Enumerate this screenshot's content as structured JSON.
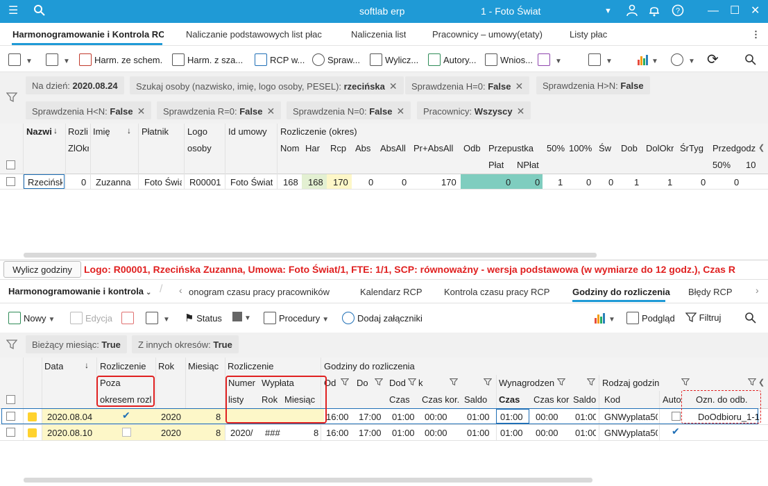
{
  "titlebar": {
    "app_title": "softlab erp",
    "company": "1 - Foto Świat",
    "icons": [
      "hamburger-icon",
      "search-icon",
      "user-icon",
      "bell-icon",
      "help-icon",
      "minimize-icon",
      "maximize-icon",
      "close-icon"
    ]
  },
  "main_tabs": [
    "Harmonogramowanie i Kontrola RCP",
    "Naliczanie podstawowych list płac",
    "Naliczenia list",
    "Pracownicy – umowy(etaty)",
    "Listy płac"
  ],
  "toolbar1": {
    "harm_schem": "Harm. ze schem.",
    "harm_sza": "Harm. z sza...",
    "rcp": "RCP w...",
    "spraw": "Spraw...",
    "wylicz": "Wylicz...",
    "autory": "Autory...",
    "wnios": "Wnios..."
  },
  "filters1": [
    {
      "label": "Na dzień: ",
      "value": "2020.08.24",
      "closable": false
    },
    {
      "label": "Szukaj osoby (nazwisko, imię, logo osoby, PESEL): ",
      "value": "rzecińska",
      "closable": true
    },
    {
      "label": "Sprawdzenia  H=0: ",
      "value": "False",
      "closable": true
    },
    {
      "label": "Sprawdzenia  H>N: ",
      "value": "False",
      "closable": false
    },
    {
      "label": "Sprawdzenia  H<N: ",
      "value": "False",
      "closable": true
    },
    {
      "label": "Sprawdzenia  R=0: ",
      "value": "False",
      "closable": true
    },
    {
      "label": "Sprawdzenia  N=0: ",
      "value": "False",
      "closable": true
    },
    {
      "label": "Pracownicy: ",
      "value": "Wszyscy",
      "closable": true
    }
  ],
  "grid1": {
    "headers": {
      "nazwisko": "Nazwi",
      "rozli": "Rozli",
      "zlokr": "ZlOkr",
      "imie": "Imię",
      "platnik": "Płatnik",
      "logo": "Logo",
      "osoby": "osoby",
      "id_umowy": "Id umowy",
      "rozliczenie_okres": "Rozliczenie (okres)",
      "nom": "Nom",
      "har": "Har",
      "rcp": "Rcp",
      "abs": "Abs",
      "absall": "AbsAll",
      "prabsall": "Pr+AbsAll",
      "odb": "Odb",
      "przepustka": "Przepustka",
      "plat": "Płat",
      "nplat": "NPłat",
      "p50": "50%",
      "p100": "100%",
      "sw": "Św",
      "dob": "Dob",
      "dolokr": "DolOkr",
      "srtyg": "ŚrTyg",
      "przedgodz": "Przedgodz",
      "pd50": "50%",
      "pd10": "10"
    },
    "row": {
      "nazwisko": "Rzeciński",
      "zlokr": "0",
      "imie": "Zuzanna",
      "platnik": "Foto Świat",
      "logo": "R00001",
      "id_umowy": "Foto Świat",
      "nom": "168",
      "har": "168",
      "rcp": "170",
      "abs": "0",
      "absall": "0",
      "prabsall": "170",
      "plat": "0",
      "nplat": "0",
      "p50": "1",
      "p100": "0",
      "sw": "0",
      "dob": "1",
      "dolokr": "1",
      "srtyg": "0",
      "przedgodz": "0"
    }
  },
  "info": {
    "button": "Wylicz godziny",
    "text": "Logo: R00001, Rzecińska Zuzanna, Umowa: Foto Świat/1, FTE: 1/1, SCP: równoważny - wersja podstawowa (w wymiarze do 12 godz.), Czas R"
  },
  "sub_tabs": {
    "module": "Harmonogramowanie i kontrola",
    "items": [
      "onogram czasu pracy pracowników",
      "Kalendarz RCP",
      "Kontrola czasu pracy RCP",
      "Godziny do rozliczenia",
      "Błędy RCP"
    ]
  },
  "toolbar2": {
    "nowy": "Nowy",
    "edycja": "Edycja",
    "status": "Status",
    "procedury": "Procedury",
    "dodaj": "Dodaj załączniki",
    "podglad": "Podgląd",
    "filtruj": "Filtruj"
  },
  "filters2": [
    {
      "label": "Bieżący miesiąc: ",
      "value": "True"
    },
    {
      "label": "Z innych okresów: ",
      "value": "True"
    }
  ],
  "grid2": {
    "headers": {
      "data": "Data",
      "rozliczenie": "Rozliczenie",
      "poza": "Poza",
      "okresem": "okresem rozl",
      "rok": "Rok",
      "miesiac": "Miesiąc",
      "rozliczenie2": "Rozliczenie",
      "numer": "Numer",
      "listy": "listy",
      "wyplata": "Wypłata",
      "w_rok": "Rok",
      "w_miesiac": "Miesiąc",
      "godziny": "Godziny do rozliczenia",
      "od": "Od",
      "do": "Do",
      "dod": "Dod",
      "k": "k",
      "czas": "Czas",
      "czas_kor": "Czas kor.",
      "saldo": "Saldo",
      "wynagrodzen": "Wynagrodzen",
      "w_czas": "Czas",
      "w_czas_kor": "Czas kor",
      "w_saldo": "Saldo",
      "rodzaj": "Rodzaj godzin",
      "kod": "Kod",
      "auto": "Auto",
      "ozn": "Ozn. do odb."
    },
    "rows": [
      {
        "data": "2020.08.04",
        "poza": true,
        "rok": "2020",
        "miesiac": "8",
        "numer": "",
        "w_rok": "",
        "w_miesiac": "",
        "od": "16:00",
        "do": "17:00",
        "dod": "01:00",
        "czas_kor": "00:00",
        "saldo": "01:00",
        "w_czas": "01:00",
        "w_czas_kor": "00:00",
        "w_saldo": "01:00",
        "kod": "GNWyplata50",
        "auto": false,
        "ozn": "DoOdbioru_1-1"
      },
      {
        "data": "2020.08.10",
        "poza": false,
        "rok": "2020",
        "miesiac": "8",
        "numer": "2020/",
        "w_rok": "###",
        "w_miesiac": "8",
        "od": "16:00",
        "do": "17:00",
        "dod": "01:00",
        "czas_kor": "00:00",
        "saldo": "01:00",
        "w_czas": "01:00",
        "w_czas_kor": "00:00",
        "w_saldo": "01:00",
        "kod": "GNWyplata50",
        "auto": true,
        "ozn": ""
      }
    ]
  },
  "colors": {
    "accent": "#1f9ad6",
    "highlight_red": "#e02020",
    "har_bg": "#e3f0d2",
    "rcp_bg": "#fdf7c8",
    "odb_bg": "#7fcdbf"
  }
}
